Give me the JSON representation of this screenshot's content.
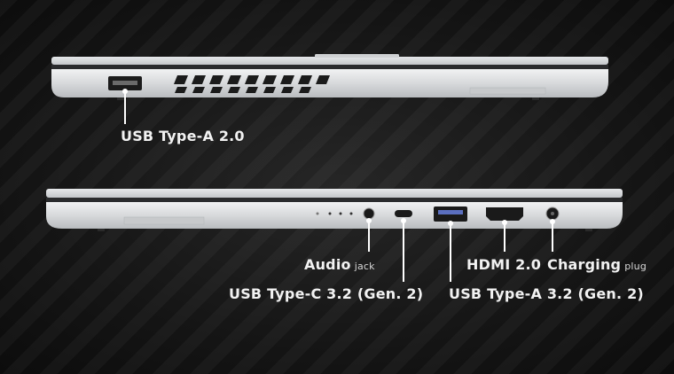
{
  "ports": {
    "usb_a_20": "USB Type-A 2.0",
    "audio": "Audio",
    "audio_suffix": "jack",
    "usb_c": "USB Type-C 3.2 (Gen. 2)",
    "hdmi": "HDMI 2.0",
    "charging": "Charging",
    "charging_suffix": "plug",
    "usb_a_32": "USB Type-A 3.2 (Gen. 2)"
  },
  "colors": {
    "background": "#141414",
    "laptop_body": "#d9dbdd",
    "port_dark": "#1a1a1a",
    "callout_line": "#ffffff"
  }
}
